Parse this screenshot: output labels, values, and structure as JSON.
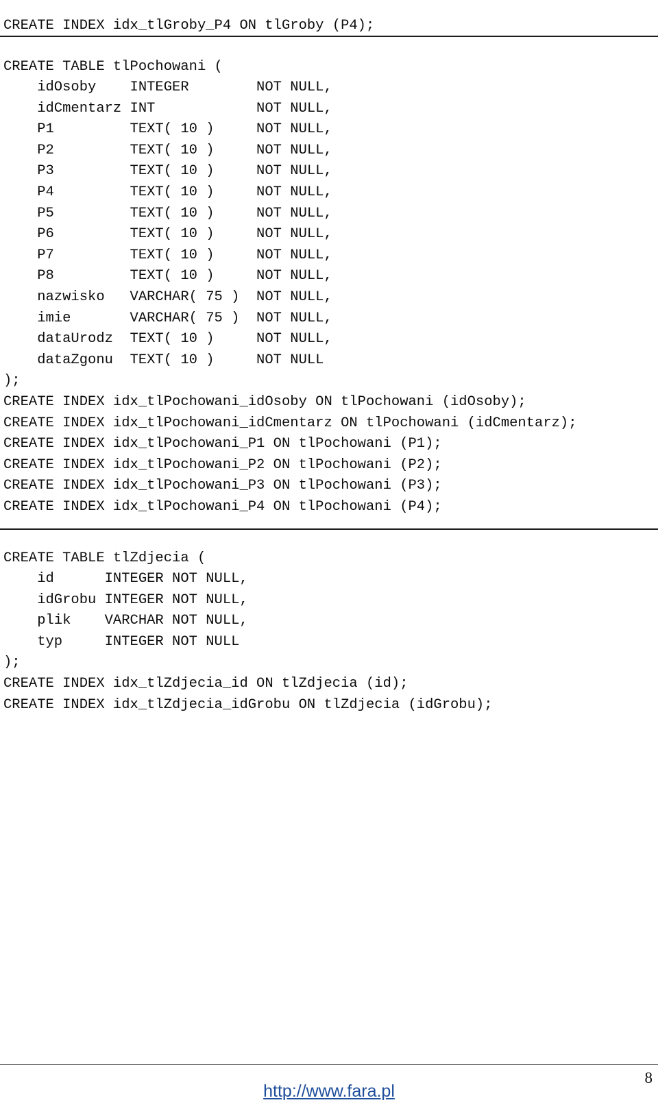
{
  "document": {
    "page_number": "8",
    "footer_link": "http://www.fara.pl",
    "link_color": "#1f4e9c"
  },
  "sections": {
    "top_statement": {
      "lines": [
        "CREATE INDEX idx_tlGroby_P4 ON tlGroby (P4);"
      ],
      "text": "CREATE INDEX idx_tlGroby_P4 ON tlGroby (P4);"
    },
    "tlPochowani": {
      "create_table_open": "CREATE TABLE tlPochowani (",
      "columns": [
        {
          "name": "idOsoby",
          "type": "INTEGER",
          "constraint": "NOT NULL,"
        },
        {
          "name": "idCmentarz",
          "type": "INT",
          "constraint": "NOT NULL,"
        },
        {
          "name": "P1",
          "type": "TEXT( 10 )",
          "constraint": "NOT NULL,"
        },
        {
          "name": "P2",
          "type": "TEXT( 10 )",
          "constraint": "NOT NULL,"
        },
        {
          "name": "P3",
          "type": "TEXT( 10 )",
          "constraint": "NOT NULL,"
        },
        {
          "name": "P4",
          "type": "TEXT( 10 )",
          "constraint": "NOT NULL,"
        },
        {
          "name": "P5",
          "type": "TEXT( 10 )",
          "constraint": "NOT NULL,"
        },
        {
          "name": "P6",
          "type": "TEXT( 10 )",
          "constraint": "NOT NULL,"
        },
        {
          "name": "P7",
          "type": "TEXT( 10 )",
          "constraint": "NOT NULL,"
        },
        {
          "name": "P8",
          "type": "TEXT( 10 )",
          "constraint": "NOT NULL,"
        },
        {
          "name": "nazwisko",
          "type": "VARCHAR( 75 )",
          "constraint": "NOT NULL,"
        },
        {
          "name": "imie",
          "type": "VARCHAR( 75 )",
          "constraint": "NOT NULL,"
        },
        {
          "name": "dataUrodz",
          "type": "TEXT( 10 )",
          "constraint": "NOT NULL,"
        },
        {
          "name": "dataZgonu",
          "type": "TEXT( 10 )",
          "constraint": "NOT NULL"
        }
      ],
      "create_table_close": ");",
      "indexes": [
        "CREATE INDEX idx_tlPochowani_idOsoby ON tlPochowani (idOsoby);",
        "CREATE INDEX idx_tlPochowani_idCmentarz ON tlPochowani (idCmentarz);",
        "CREATE INDEX idx_tlPochowani_P1 ON tlPochowani (P1);",
        "CREATE INDEX idx_tlPochowani_P2 ON tlPochowani (P2);",
        "CREATE INDEX idx_tlPochowani_P3 ON tlPochowani (P3);",
        "CREATE INDEX idx_tlPochowani_P4 ON tlPochowani (P4);"
      ],
      "text": "CREATE TABLE tlPochowani (\n    idOsoby    INTEGER        NOT NULL,\n    idCmentarz INT            NOT NULL,\n    P1         TEXT( 10 )     NOT NULL,\n    P2         TEXT( 10 )     NOT NULL,\n    P3         TEXT( 10 )     NOT NULL,\n    P4         TEXT( 10 )     NOT NULL,\n    P5         TEXT( 10 )     NOT NULL,\n    P6         TEXT( 10 )     NOT NULL,\n    P7         TEXT( 10 )     NOT NULL,\n    P8         TEXT( 10 )     NOT NULL,\n    nazwisko   VARCHAR( 75 )  NOT NULL,\n    imie       VARCHAR( 75 )  NOT NULL,\n    dataUrodz  TEXT( 10 )     NOT NULL,\n    dataZgonu  TEXT( 10 )     NOT NULL\n);\nCREATE INDEX idx_tlPochowani_idOsoby ON tlPochowani (idOsoby);\nCREATE INDEX idx_tlPochowani_idCmentarz ON tlPochowani (idCmentarz);\nCREATE INDEX idx_tlPochowani_P1 ON tlPochowani (P1);\nCREATE INDEX idx_tlPochowani_P2 ON tlPochowani (P2);\nCREATE INDEX idx_tlPochowani_P3 ON tlPochowani (P3);\nCREATE INDEX idx_tlPochowani_P4 ON tlPochowani (P4);"
    },
    "tlZdjecia": {
      "create_table_open": "CREATE TABLE tlZdjecia (",
      "columns": [
        {
          "name": "id",
          "type": "INTEGER",
          "constraint": "NOT NULL,"
        },
        {
          "name": "idGrobu",
          "type": "INTEGER",
          "constraint": "NOT NULL,"
        },
        {
          "name": "plik",
          "type": "VARCHAR",
          "constraint": "NOT NULL,"
        },
        {
          "name": "typ",
          "type": "INTEGER",
          "constraint": "NOT NULL"
        }
      ],
      "create_table_close": ");",
      "indexes": [
        "CREATE INDEX idx_tlZdjecia_id ON tlZdjecia (id);",
        "CREATE INDEX idx_tlZdjecia_idGrobu ON tlZdjecia (idGrobu);"
      ],
      "text": "CREATE TABLE tlZdjecia (\n    id      INTEGER NOT NULL,\n    idGrobu INTEGER NOT NULL,\n    plik    VARCHAR NOT NULL,\n    typ     INTEGER NOT NULL\n);\nCREATE INDEX idx_tlZdjecia_id ON tlZdjecia (id);\nCREATE INDEX idx_tlZdjecia_idGrobu ON tlZdjecia (idGrobu);"
    }
  }
}
